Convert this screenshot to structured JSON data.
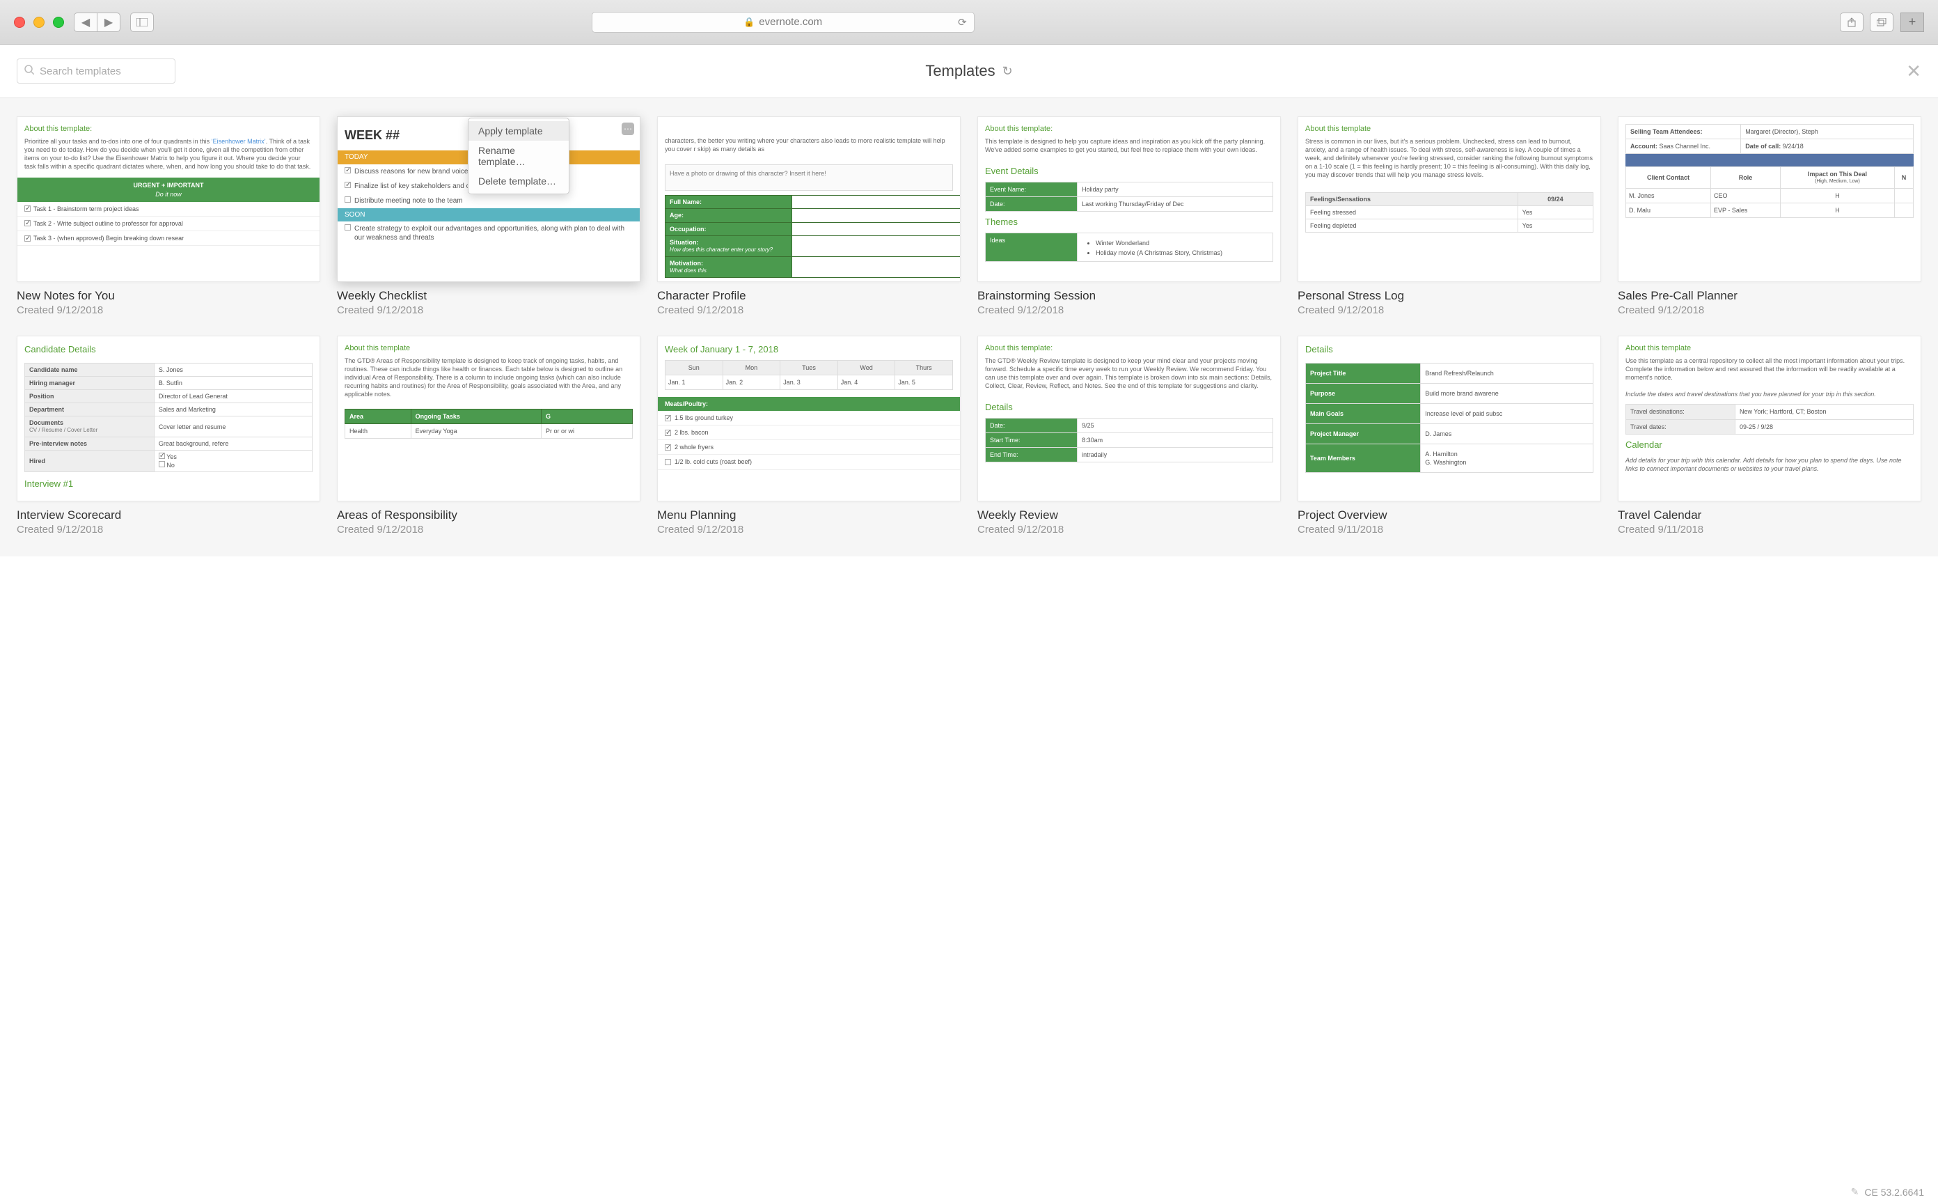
{
  "browser": {
    "url": "evernote.com",
    "newtab": "+"
  },
  "header": {
    "search_placeholder": "Search templates",
    "title": "Templates"
  },
  "ctx": {
    "apply": "Apply template",
    "rename": "Rename template…",
    "delete": "Delete template…"
  },
  "footer": {
    "version": "CE 53.2.6641"
  },
  "cards": [
    {
      "title": "New Notes for You",
      "date": "Created 9/12/2018",
      "about": "About this template:",
      "desc_pre": "Prioritize all your tasks and to-dos into one of four quadrants in this ",
      "link": "‘Eisenhower Matrix’",
      "desc_post": ". Think of a task you need to do today. How do you decide when you'll get it done, given all the competition from other items on your to-do list? Use the Eisenhower Matrix to help you figure it out. Where you decide your task falls within a specific quadrant dictates where, when, and how long you should take to do that task.",
      "urgent": "URGENT + IMPORTANT",
      "doit": "Do it now",
      "tasks": [
        "Task 1 - Brainstorm term project ideas",
        "Task 2 - Write subject outline to professor for approval",
        "Task 3 - (when approved) Begin breaking down resear"
      ]
    },
    {
      "title": "Weekly Checklist",
      "date": "Created 9/12/2018",
      "week": "WEEK ##",
      "today": "TODAY",
      "soon": "SOON",
      "t1": "Discuss reasons for new brand voice and design for website/app",
      "t2": "Finalize list of key stakeholders and creative team",
      "t3": "Distribute meeting note to the team",
      "s1": "Create strategy to exploit our advantages and opportunities, along with plan to deal with our weakness and threats"
    },
    {
      "title": "Character Profile",
      "date": "Created 9/12/2018",
      "desc": "characters, the better you writing where your characters also leads to more realistic template will help you cover r skip) as many details as",
      "draw": "Have a photo or drawing of this character? Insert it here!",
      "rows": [
        {
          "k": "Full Name:",
          "v": ""
        },
        {
          "k": "Age:",
          "v": ""
        },
        {
          "k": "Occupation:",
          "v": ""
        }
      ],
      "sit_k": "Situation:",
      "sit_sub": "How does this character enter your story?",
      "mot_k": "Motivation:",
      "mot_sub": "What does this"
    },
    {
      "title": "Brainstorming Session",
      "date": "Created 9/12/2018",
      "about": "About this template:",
      "desc": "This template is designed to help you capture ideas and inspiration as you kick off the party planning. We've added some examples to get you started, but feel free to replace them with your own ideas.",
      "sec_event": "Event Details",
      "ev_name_k": "Event Name:",
      "ev_name_v": "Holiday party",
      "ev_date_k": "Date:",
      "ev_date_v": "Last working Thursday/Friday of Dec",
      "sec_themes": "Themes",
      "ideas_k": "Ideas",
      "bullets": [
        "Winter Wonderland",
        "Holiday movie (A Christmas Story, Christmas)"
      ]
    },
    {
      "title": "Personal Stress Log",
      "date": "Created 9/12/2018",
      "about": "About this template",
      "desc": "Stress is common in our lives, but it's a serious problem. Unchecked, stress can lead to burnout, anxiety, and a range of health issues. To deal with stress, self-awareness is key. A couple of times a week, and definitely whenever you're feeling stressed, consider ranking the following burnout symptoms on a 1-10 scale (1 = this feeling is hardly present; 10 = this feeling is all-consuming). With this daily log, you may discover trends that will help you manage stress levels.",
      "th1": "Feelings/Sensations",
      "th2": "09/24",
      "r1k": "Feeling stressed",
      "r1v": "Yes",
      "r2k": "Feeling depleted",
      "r2v": "Yes"
    },
    {
      "title": "Sales Pre-Call Planner",
      "date": "Created 9/12/2018",
      "k1": "Selling Team Attendees:",
      "v1": "Margaret (Director), Steph",
      "k2": "Account:",
      "v2": "Saas Channel Inc.",
      "k3": "Date of call:",
      "v3": "9/24/18",
      "h1": "Client Contact",
      "h2": "Role",
      "h3": "Impact on This Deal",
      "h3s": "(High, Medium, Low)",
      "h4": "N",
      "r1": [
        "M. Jones",
        "CEO",
        "H",
        ""
      ],
      "r2": [
        "D. Malu",
        "EVP - Sales",
        "H",
        ""
      ]
    },
    {
      "title": "Interview Scorecard",
      "date": "Created 9/12/2018",
      "h": "Candidate Details",
      "rows": [
        {
          "k": "Candidate name",
          "v": "S. Jones"
        },
        {
          "k": "Hiring manager",
          "v": "B. Sutfin"
        },
        {
          "k": "Position",
          "v": "Director of Lead Generat"
        },
        {
          "k": "Department",
          "v": "Sales and Marketing"
        }
      ],
      "docs_k": "Documents",
      "docs_sub": "CV / Resume / Cover Letter",
      "docs_v": "Cover letter and resume",
      "pre_k": "Pre-interview notes",
      "pre_v": "Great background, refere",
      "hired_k": "Hired",
      "yes": "Yes",
      "no": "No",
      "int1": "Interview #1"
    },
    {
      "title": "Areas of Responsibility",
      "date": "Created 9/12/2018",
      "about": "About this template",
      "desc": "The GTD® Areas of Responsibility template is designed to keep track of ongoing tasks, habits, and routines. These can include things like health or finances. Each table below is designed to outline an individual Area of Responsibility. There is a column to include ongoing tasks (which can also include recurring habits and routines) for the Area of Responsibility, goals associated with the Area, and any applicable notes.",
      "th": [
        "Area",
        "Ongoing Tasks",
        "G"
      ],
      "r": [
        "Health",
        "Everyday Yoga",
        "Pr or or wi"
      ]
    },
    {
      "title": "Menu Planning",
      "date": "Created 9/12/2018",
      "week": "Week of January 1 - 7, 2018",
      "days": [
        "Sun",
        "Mon",
        "Tues",
        "Wed",
        "Thurs"
      ],
      "dates": [
        "Jan. 1",
        "Jan. 2",
        "Jan. 3",
        "Jan. 4",
        "Jan. 5"
      ],
      "meat": "Meats/Poultry:",
      "items": [
        "1.5 lbs ground turkey",
        "2 lbs. bacon",
        "2 whole fryers",
        "1/2 lb. cold cuts (roast beef)"
      ]
    },
    {
      "title": "Weekly Review",
      "date": "Created 9/12/2018",
      "about": "About this template:",
      "desc": "The GTD® Weekly Review template is designed to keep your mind clear and your projects moving forward. Schedule a specific time every week to run your Weekly Review. We recommend Friday. You can use this template over and over again. This template is broken down into six main sections: Details, Collect, Clear, Review, Reflect, and Notes.  See the end of this template for suggestions and clarity.",
      "sec": "Details",
      "r": [
        [
          "Date:",
          "9/25"
        ],
        [
          "Start Time:",
          "8:30am"
        ],
        [
          "End Time:",
          "intradaily"
        ]
      ]
    },
    {
      "title": "Project Overview",
      "date": "Created 9/11/2018",
      "sec": "Details",
      "rows": [
        [
          "Project Title",
          "Brand Refresh/Relaunch"
        ],
        [
          "Purpose",
          "Build more brand awarene"
        ],
        [
          "Main Goals",
          "Increase level of paid subsc"
        ],
        [
          "Project Manager",
          "D. James"
        ],
        [
          "Team Members",
          "A. Hamilton\nG. Washington"
        ]
      ]
    },
    {
      "title": "Travel Calendar",
      "date": "Created 9/11/2018",
      "about": "About this template",
      "desc": "Use this template as a central repository to collect all the most important information about your trips. Complete the information below and rest assured that the information will be readily available at a moment's notice.",
      "ital1": "Include the dates and travel destinations that you have planned for your trip in this section.",
      "r": [
        [
          "Travel destinations:",
          "New York; Hartford, CT; Boston"
        ],
        [
          "Travel dates:",
          "09-25 / 9/28"
        ]
      ],
      "cal": "Calendar",
      "ital2": "Add details for your trip with this calendar. Add details for how you plan to spend the days. Use note links to connect important documents or websites to your travel plans."
    }
  ]
}
